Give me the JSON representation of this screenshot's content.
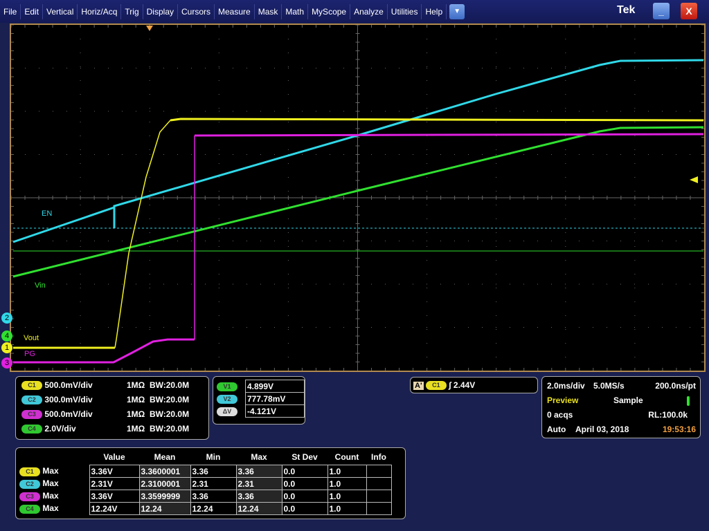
{
  "menubar": {
    "items": [
      "File",
      "Edit",
      "Vertical",
      "Horiz/Acq",
      "Trig",
      "Display",
      "Cursors",
      "Measure",
      "Mask",
      "Math",
      "MyScope",
      "Analyze",
      "Utilities",
      "Help"
    ],
    "brand": "Tek",
    "minimize": "_",
    "close": "X"
  },
  "colors": {
    "ch1": "#f0f020",
    "ch2": "#30d8e8",
    "ch3": "#e020e0",
    "ch4": "#30e030",
    "border": "#b08a50",
    "time": "#f0a040"
  },
  "waveform": {
    "labels": {
      "en": "EN",
      "vin": "Vin",
      "vout": "Vout",
      "pg": "PG"
    },
    "markers": [
      "2",
      "4",
      "1",
      "3"
    ]
  },
  "channels": [
    {
      "id": "C1",
      "scale": "500.0mV/div",
      "impedance": "1MΩ",
      "bw": "W:20.0M"
    },
    {
      "id": "C2",
      "scale": "300.0mV/div",
      "impedance": "1MΩ",
      "bw": "W:20.0M"
    },
    {
      "id": "C3",
      "scale": "500.0mV/div",
      "impedance": "1MΩ",
      "bw": "W:20.0M"
    },
    {
      "id": "C4",
      "scale": "2.0V/div",
      "impedance": "1MΩ",
      "bw": "W:20.0M"
    }
  ],
  "cursors": [
    {
      "id": "V1",
      "value": "4.899V"
    },
    {
      "id": "V2",
      "value": "777.78mV"
    },
    {
      "id": "ΔV",
      "value": "-4.121V"
    }
  ],
  "trigger": {
    "mode": "A'",
    "source": "C1",
    "level": "2.44V"
  },
  "acq": {
    "timebase": "2.0ms/div",
    "rate": "5.0MS/s",
    "resolution": "200.0ns/pt",
    "state": "Preview",
    "mode": "Sample",
    "acqs": "0 acqs",
    "record": "RL:100.0k",
    "trig_mode": "Auto",
    "date": "April 03, 2018",
    "time": "19:53:16"
  },
  "measurements": {
    "headers": [
      "Value",
      "Mean",
      "Min",
      "Max",
      "St Dev",
      "Count",
      "Info"
    ],
    "rows": [
      {
        "ch": "C1",
        "type": "Max",
        "cells": [
          "3.36V",
          "3.3600001",
          "3.36",
          "3.36",
          "0.0",
          "1.0",
          ""
        ]
      },
      {
        "ch": "C2",
        "type": "Max",
        "cells": [
          "2.31V",
          "2.3100001",
          "2.31",
          "2.31",
          "0.0",
          "1.0",
          ""
        ]
      },
      {
        "ch": "C3",
        "type": "Max",
        "cells": [
          "3.36V",
          "3.3599999",
          "3.36",
          "3.36",
          "0.0",
          "1.0",
          ""
        ]
      },
      {
        "ch": "C4",
        "type": "Max",
        "cells": [
          "12.24V",
          "12.24",
          "12.24",
          "12.24",
          "0.0",
          "1.0",
          ""
        ]
      }
    ]
  }
}
